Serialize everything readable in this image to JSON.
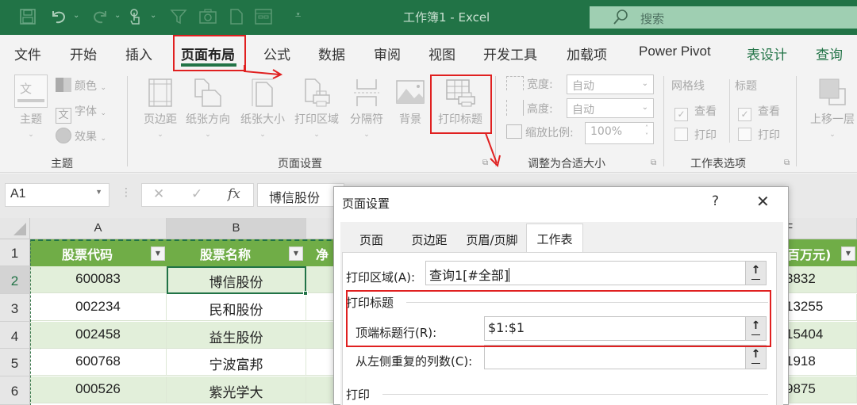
{
  "window": {
    "title": "工作簿1 - Excel",
    "search_placeholder": "搜索",
    "quick_access": [
      "save-icon",
      "undo-icon",
      "redo-icon",
      "touch-mode-icon",
      "filter-icon",
      "camera-icon",
      "new-file-icon",
      "form-icon",
      "customize-qat-icon"
    ]
  },
  "ribbon_tabs": [
    {
      "label": "文件"
    },
    {
      "label": "开始"
    },
    {
      "label": "插入"
    },
    {
      "label": "页面布局",
      "active": true
    },
    {
      "label": "公式"
    },
    {
      "label": "数据"
    },
    {
      "label": "审阅"
    },
    {
      "label": "视图"
    },
    {
      "label": "开发工具"
    },
    {
      "label": "加载项"
    },
    {
      "label": "Power Pivot"
    },
    {
      "label": "表设计",
      "contextual": true
    },
    {
      "label": "查询",
      "contextual": true
    }
  ],
  "ribbon": {
    "theme_group": {
      "label": "主题",
      "themes_button": "主题",
      "theme_preview_glyph": "文",
      "colors": "颜色",
      "fonts": "字体",
      "fonts_glyph": "文",
      "effects": "效果"
    },
    "page_setup_group": {
      "label": "页面设置",
      "buttons": [
        "页边距",
        "纸张方向",
        "纸张大小",
        "打印区域",
        "分隔符",
        "背景",
        "打印标题"
      ]
    },
    "scale_group": {
      "label": "调整为合适大小",
      "width_label": "宽度:",
      "width_value": "自动",
      "height_label": "高度:",
      "height_value": "自动",
      "scale_label": "缩放比例:",
      "scale_value": "100%"
    },
    "sheet_options_group": {
      "label": "工作表选项",
      "gridlines_header": "网格线",
      "headings_header": "标题",
      "view_label": "查看",
      "print_label": "打印",
      "gridlines_view": true,
      "gridlines_print": false,
      "headings_view": true,
      "headings_print": false
    },
    "arrange_group": {
      "bring_forward": "上移一层"
    }
  },
  "formula_bar": {
    "name_box": "A1",
    "cancel_glyph": "✕",
    "enter_glyph": "✓",
    "fx_glyph": "fx",
    "content": "博信股份"
  },
  "sheet": {
    "columns": [
      "A",
      "B",
      "F"
    ],
    "rows": [
      "1",
      "2",
      "3",
      "4",
      "5",
      "6"
    ],
    "headers": [
      "股票代码",
      "股票名称",
      "净",
      "百万元)"
    ],
    "data": [
      {
        "code": "600083",
        "name": "博信股份",
        "f": "3832"
      },
      {
        "code": "002234",
        "name": "民和股份",
        "f": "13255"
      },
      {
        "code": "002458",
        "name": "益生股份",
        "f": "15404"
      },
      {
        "code": "600768",
        "name": "宁波富邦",
        "f": "1918"
      },
      {
        "code": "000526",
        "name": "紫光学大",
        "f": "9875"
      }
    ]
  },
  "dialog": {
    "title": "页面设置",
    "help": "?",
    "close": "✕",
    "tabs": [
      {
        "label": "页面"
      },
      {
        "label": "页边距"
      },
      {
        "label": "页眉/页脚"
      },
      {
        "label": "工作表",
        "active": true
      }
    ],
    "print_area_label": "打印区域(A):",
    "print_area_value": "查询1[#全部]",
    "print_titles_section": "打印标题",
    "rows_to_repeat_label": "顶端标题行(R):",
    "rows_to_repeat_value": "$1:$1",
    "cols_to_repeat_label": "从左侧重复的列数(C):",
    "cols_to_repeat_value": "",
    "print_section": "打印",
    "ref_glyph": "↑"
  },
  "colors": {
    "excel_green": "#217346",
    "table_header_green": "#70ad47",
    "band_green": "#e2efda",
    "annotation_red": "#e02020"
  }
}
